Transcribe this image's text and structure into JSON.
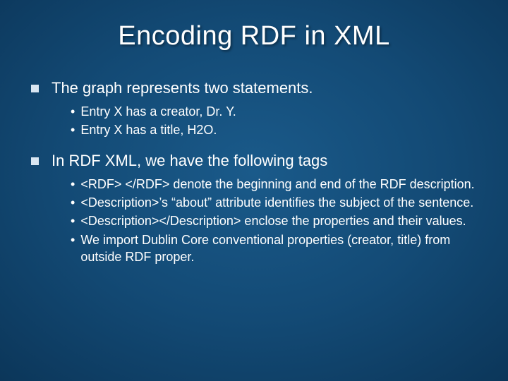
{
  "title": "Encoding RDF in XML",
  "bullets": [
    {
      "text": "The graph represents two statements.",
      "sub": [
        "Entry X has a creator, Dr. Y.",
        "Entry X has a title, H2O."
      ]
    },
    {
      "text": "In RDF XML, we have the following tags",
      "sub": [
        "<RDF> </RDF> denote the beginning and end of the RDF description.",
        "<Description>’s “about” attribute identifies the subject of the sentence.",
        "<Description></Description> enclose the properties and their values.",
        "We import Dublin Core conventional properties (creator, title) from outside RDF proper."
      ]
    }
  ]
}
